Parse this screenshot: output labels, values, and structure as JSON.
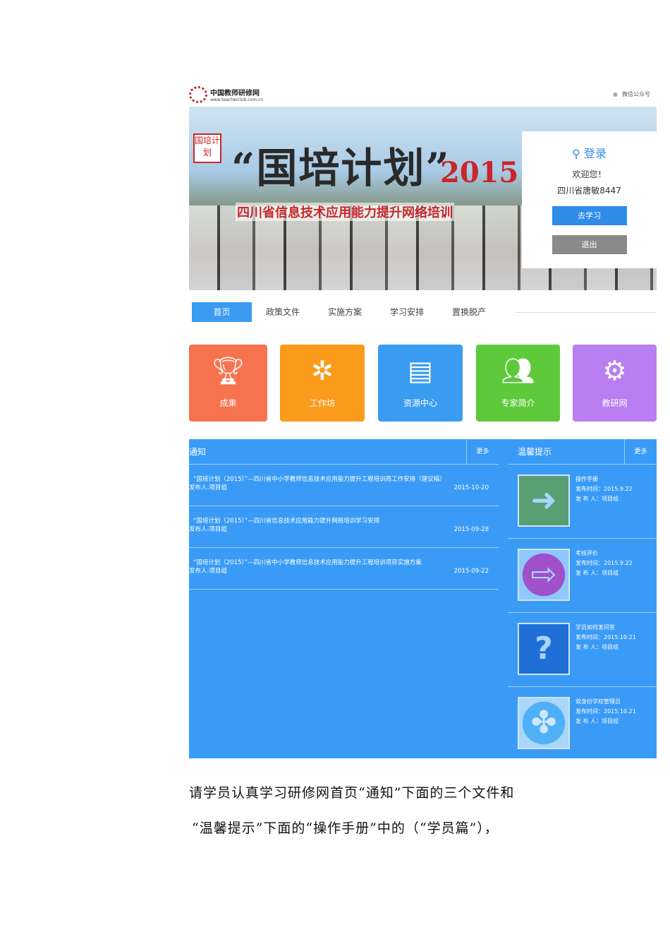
{
  "header": {
    "logo_title": "中国教师研修网",
    "logo_url_text": "www.teacherclub.com.cn",
    "wechat": "微信公众号"
  },
  "banner": {
    "seal": "国培计划",
    "title": "“国培计划”",
    "year": "2015",
    "subtitle": "四川省信息技术应用能力提升网络培训"
  },
  "login": {
    "title": "登录",
    "welcome": "欢迎您！",
    "username": "四川省唐敏8447",
    "study_button": "去学习",
    "logout_button": "退出"
  },
  "nav": [
    "首页",
    "政策文件",
    "实施方案",
    "学习安排",
    "置换脱产"
  ],
  "tiles": [
    {
      "label": "成果",
      "color": "#f7734f"
    },
    {
      "label": "工作坊",
      "color": "#fa9b1c"
    },
    {
      "label": "资源中心",
      "color": "#3a9cf0"
    },
    {
      "label": "专家简介",
      "color": "#5ec93b"
    },
    {
      "label": "教研网",
      "color": "#b87ef2"
    }
  ],
  "notice": {
    "title": "通知",
    "more": "更多",
    "items": [
      {
        "title": "“国培计划（2015）”—四川省中小学教师信息技术应用能力提升工程培训周工作安排（建议稿）",
        "publisher": "发布人:项目组",
        "date": "2015-10-20"
      },
      {
        "title": "“国培计划（2015）”—四川省信息技术应用能力提升网络培训学习安排",
        "publisher": "发布人:项目组",
        "date": "2015-09-28"
      },
      {
        "title": "“国培计划（2015）”—四川省中小学教师信息技术应用能力提升工程培训项目实施方案",
        "publisher": "发布人:项目组",
        "date": "2015-09-22"
      }
    ]
  },
  "tips": {
    "title": "温馨提示",
    "more": "更多",
    "items": [
      {
        "title": "操作手册",
        "time": "发布时间：2015.9.22",
        "publisher": "发 布 人：项目组"
      },
      {
        "title": "考核评价",
        "time": "发布时间：2015.9.22",
        "publisher": "发 布 人：项目组"
      },
      {
        "title": "学员如何发问答",
        "time": "发布时间：2015.10.21",
        "publisher": "发 布 人：项目组"
      },
      {
        "title": "双身份学校管理员",
        "time": "发布时间：2015.10.21",
        "publisher": "发 布 人：项目组"
      }
    ]
  },
  "caption": {
    "line1": "请学员认真学习研修网首页“通知”下面的三个文件和",
    "line2": "“温馨提示”下面的“操作手册”中的（“学员篇”），"
  }
}
